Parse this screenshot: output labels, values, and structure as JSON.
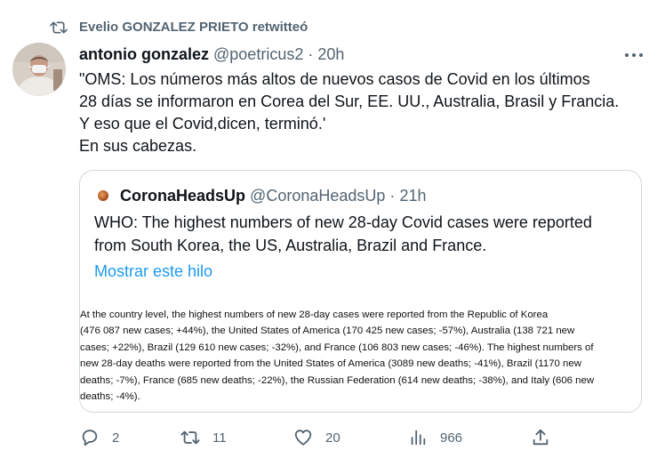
{
  "retweet": {
    "text": "Evelio GONZALEZ PRIETO retwitteó"
  },
  "tweet": {
    "author_name": "antonio gonzalez",
    "author_handle": "@poetricus2",
    "separator": "·",
    "time": "20h",
    "text_lines": [
      "\"OMS: Los números más altos de nuevos casos de Covid en los últimos",
      "28 días se informaron en Corea del Sur, EE. UU., Australia, Brasil y Francia.",
      "Y eso que el Covid,dicen, terminó.'",
      "En sus cabezas."
    ]
  },
  "quoted": {
    "author_name": "CoronaHeadsUp",
    "author_handle": "@CoronaHeadsUp",
    "separator": "·",
    "time": "21h",
    "text_lines": [
      "WHO: The highest numbers of new 28-day Covid cases were reported",
      "from South Korea, the US, Australia, Brazil and France."
    ],
    "show_thread": "Mostrar este hilo",
    "image_text_lines": [
      "At the country level, the highest numbers of new 28-day cases were reported from the Republic of Korea",
      "(476 087 new cases; +44%), the United States of America (170 425 new cases; -57%), Australia (138 721 new",
      "cases; +22%), Brazil (129 610 new cases; -32%), and France (106 803 new cases; -46%). The highest numbers of",
      "new 28-day deaths were reported from the United States of America (3089 new deaths; -41%), Brazil (1170 new",
      "deaths; -7%), France (685 new deaths; -22%), the Russian Federation (614 new deaths; -38%), and Italy (606 new",
      "deaths; -4%)."
    ]
  },
  "actions": {
    "reply_count": "2",
    "retweet_count": "11",
    "like_count": "20",
    "views_count": "966"
  },
  "icons": {
    "retweet_banner": "retweet-icon",
    "more": "more-icon",
    "reply": "reply-icon",
    "retweet": "retweet-icon",
    "like": "heart-icon",
    "views": "views-icon",
    "share": "share-icon"
  },
  "colors": {
    "text_primary": "#0f1419",
    "text_secondary": "#536471",
    "link": "#1d9bf0",
    "border": "#cfd9de"
  }
}
